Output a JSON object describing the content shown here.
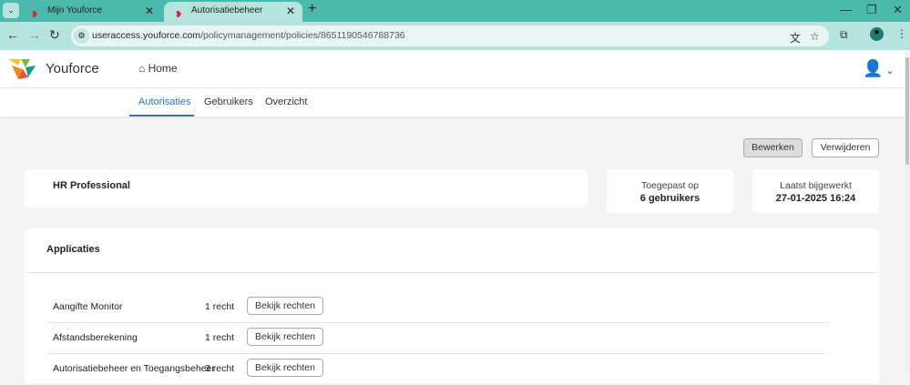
{
  "browser": {
    "tabs": [
      {
        "title": "Mijn Youforce"
      },
      {
        "title": "Autorisatiebeheer"
      }
    ],
    "url_host": "useraccess.youforce.com",
    "url_path": "/policymanagement/policies/8651190546788736"
  },
  "header": {
    "brand": "Youforce",
    "home": "Home"
  },
  "subnav": {
    "tabs": [
      "Autorisaties",
      "Gebruikers",
      "Overzicht"
    ],
    "active": "Autorisaties"
  },
  "actions": {
    "edit": "Bewerken",
    "delete": "Verwijderen"
  },
  "policy": {
    "name": "HR Professional",
    "applied_label": "Toegepast op",
    "applied_value": "6 gebruikers",
    "updated_label": "Laatst bijgewerkt",
    "updated_value": "27-01-2025 16:24"
  },
  "applications": {
    "title": "Applicaties",
    "button_label": "Bekijk rechten",
    "rows": [
      {
        "name": "Aangifte Monitor",
        "count": "1 recht"
      },
      {
        "name": "Afstandsberekening",
        "count": "1 recht"
      },
      {
        "name": "Autorisatiebeheer en Toegangsbeheer",
        "count": "3 recht"
      }
    ]
  }
}
